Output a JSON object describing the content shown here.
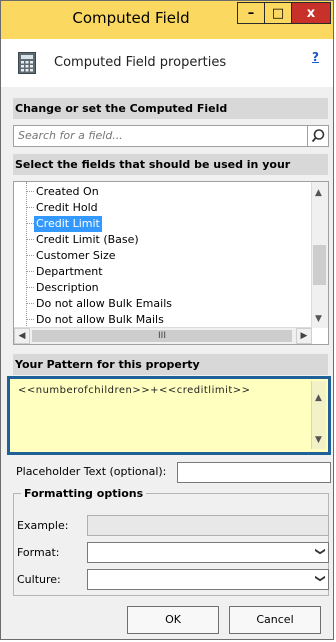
{
  "window": {
    "title": "Computed Field",
    "minimize_label": "–",
    "maximize_label": "□",
    "close_label": "x"
  },
  "header": {
    "label": "Computed Field properties",
    "help_label": "?"
  },
  "sections": {
    "change": "Change or set the Computed Field",
    "select": "Select the fields that should be used in your Pattern",
    "pattern": "Your Pattern for this property"
  },
  "search": {
    "placeholder": "Search for a field..."
  },
  "field_list": {
    "items": [
      "Created On",
      "Credit Hold",
      "Credit Limit",
      "Credit Limit (Base)",
      "Customer Size",
      "Department",
      "Description",
      "Do not allow Bulk Emails",
      "Do not allow Bulk Mails"
    ],
    "selected": "Credit Limit",
    "hscroll_grip": "III"
  },
  "pattern": {
    "value": "<<numberofchildren>>+<<creditlimit>>"
  },
  "placeholder_text": {
    "label": "Placeholder Text (optional):",
    "value": ""
  },
  "formatting": {
    "legend": "Formatting options",
    "example_label": "Example:",
    "format_label": "Format:",
    "culture_label": "Culture:"
  },
  "buttons": {
    "ok": "OK",
    "cancel": "Cancel"
  },
  "colors": {
    "titlebar": "#fbd961",
    "close": "#c7312a",
    "pattern_bg": "#ffffbf",
    "highlight_border": "#1d6198",
    "selection": "#3399ff"
  }
}
